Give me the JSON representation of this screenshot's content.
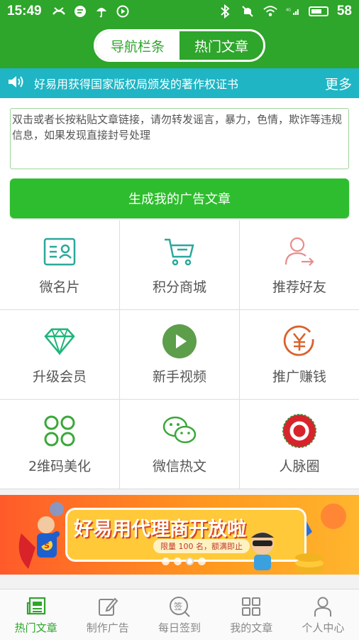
{
  "status_bar": {
    "time": "15:49",
    "battery": "58"
  },
  "header": {
    "tabs": [
      {
        "label": "导航栏条"
      },
      {
        "label": "热门文章"
      }
    ]
  },
  "notice": {
    "text": "好易用获得国家版权局颁发的著作权证书",
    "more": "更多"
  },
  "editor": {
    "placeholder": "双击或者长按粘贴文章链接，请勿转发谣言，暴力，色情，欺诈等违规信息，如果发现直接封号处理",
    "value": "",
    "generate_button": "生成我的广告文章"
  },
  "grid": {
    "items": [
      {
        "label": "微名片",
        "icon": "name-card-icon"
      },
      {
        "label": "积分商城",
        "icon": "shopping-cart-icon"
      },
      {
        "label": "推荐好友",
        "icon": "user-share-icon"
      },
      {
        "label": "升级会员",
        "icon": "diamond-icon"
      },
      {
        "label": "新手视频",
        "icon": "play-icon"
      },
      {
        "label": "推广赚钱",
        "icon": "yen-coin-icon"
      },
      {
        "label": "2维码美化",
        "icon": "clover-icon"
      },
      {
        "label": "微信热文",
        "icon": "wechat-icon"
      },
      {
        "label": "人脉圈",
        "icon": "ring-icon"
      }
    ]
  },
  "banner": {
    "title": "好易用代理商开放啦",
    "subtitle": "限量 100 名，额满即止"
  },
  "tabbar": {
    "items": [
      {
        "label": "热门文章",
        "icon": "newspaper-icon",
        "active": true
      },
      {
        "label": "制作广告",
        "icon": "edit-icon",
        "active": false
      },
      {
        "label": "每日签到",
        "icon": "sign-in-icon",
        "active": false
      },
      {
        "label": "我的文章",
        "icon": "grid-icon",
        "active": false
      },
      {
        "label": "个人中心",
        "icon": "person-icon",
        "active": false
      }
    ]
  },
  "colors": {
    "primary": "#2ea52b",
    "notice": "#1fb5c4",
    "button": "#2ebd2e"
  }
}
